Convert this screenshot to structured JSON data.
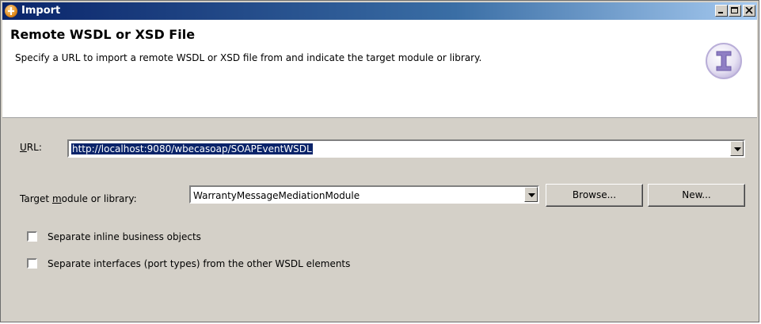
{
  "window": {
    "title": "Import",
    "icon": "import-wizard-icon"
  },
  "header": {
    "title": "Remote WSDL or XSD File",
    "description": "Specify a URL to import a remote WSDL or XSD file from and indicate the target module or library.",
    "emblem_icon": "import-emblem-icon"
  },
  "form": {
    "url_label_prefix": "U",
    "url_label_rest": "RL:",
    "url_value": "http://localhost:9080/wbecasoap/SOAPEventWSDL",
    "target_label_pre": "Target ",
    "target_label_u": "m",
    "target_label_post": "odule or library:",
    "target_value": "WarrantyMessageMediationModule",
    "browse_label": "Browse...",
    "new_label": "New...",
    "checkbox1_label": "Separate inline business objects",
    "checkbox1_checked": false,
    "checkbox2_label": "Separate interfaces (port types) from the other WSDL elements",
    "checkbox2_checked": false
  },
  "colors": {
    "titlebar_start": "#0a246a",
    "titlebar_end": "#a6caf0",
    "selection": "#0a246a"
  }
}
